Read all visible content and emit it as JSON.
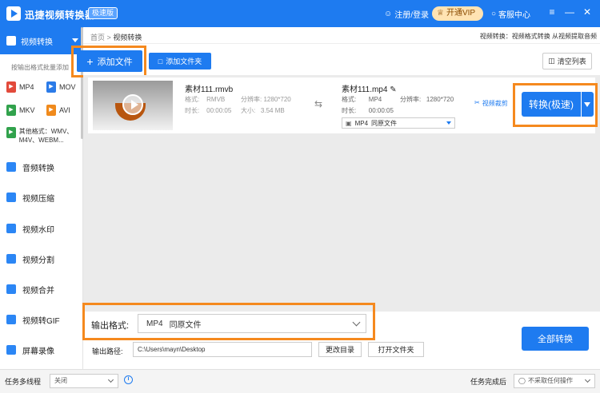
{
  "titlebar": {
    "title": "迅捷视频转换器",
    "badge": "极速版",
    "login": "注册/登录",
    "vip": "开通VIP",
    "service": "客服中心",
    "win_menu": "≡",
    "win_min": "—",
    "win_close": "✕"
  },
  "sidebar": {
    "active": "视频转换",
    "hint": "按输出格式批量添加",
    "formats": [
      "MP4",
      "MOV",
      "MKV",
      "AVI"
    ],
    "other_formats": "其他格式：WMV、M4V、WEBM...",
    "items": [
      "音频转换",
      "视频压缩",
      "视频水印",
      "视频分割",
      "视频合并",
      "视频转GIF",
      "屏幕录像"
    ]
  },
  "breadcrumb": {
    "home": "首页",
    "sep": ">",
    "current": "视频转换",
    "right_text": "视频转换：视频格式转换 从视频提取音频"
  },
  "toolbar": {
    "add_file": "添加文件",
    "add_folder": "添加文件夹",
    "clear_list": "清空列表"
  },
  "file": {
    "src_name": "素材111.rmvb",
    "src_format_label": "格式:",
    "src_format": "RMVB",
    "src_res_label": "分辨率:",
    "src_res": "1280*720",
    "src_dur_label": "时长:",
    "src_dur": "00:00:05",
    "src_size_label": "大小:",
    "src_size": "3.54 MB",
    "dst_name": "素材111.mp4",
    "dst_format_label": "格式:",
    "dst_format": "MP4",
    "dst_res_label": "分辨率:",
    "dst_res": "1280*720",
    "dst_dur_label": "时长:",
    "dst_dur": "00:00:05",
    "dst_select_fmt": "MP4",
    "dst_select_quality": "同原文件",
    "trim": "视频裁剪",
    "convert_btn": "转换(极速)"
  },
  "output": {
    "format_label": "输出格式:",
    "format_value": "MP4",
    "quality_value": "同原文件",
    "path_label": "输出路径:",
    "path_value": "C:\\Users\\mayn\\Desktop",
    "change_dir": "更改目录",
    "open_folder": "打开文件夹",
    "convert_all": "全部转换"
  },
  "statusbar": {
    "multithread_label": "任务多线程",
    "multithread_value": "关闭",
    "info": "i",
    "after_label": "任务完成后",
    "after_value": "不采取任何操作"
  },
  "colors": {
    "primary": "#1e7bf0",
    "highlight": "#f5891e"
  }
}
